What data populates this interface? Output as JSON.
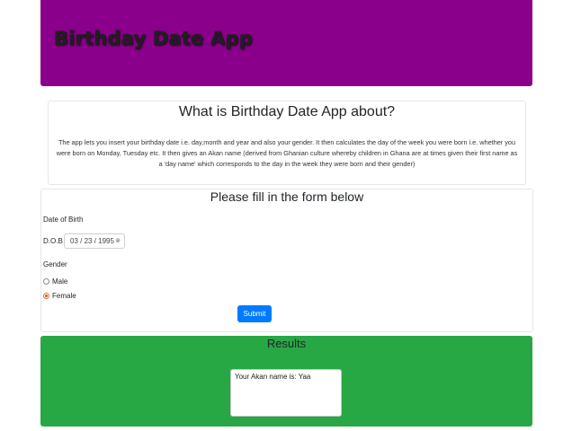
{
  "header": {
    "title": "Birthday Date App",
    "background_color": "#8b008b"
  },
  "about": {
    "heading": "What is Birthday Date App about?",
    "description": "The app lets you insert your birthday date i.e. day,month and year and also your gender. It then calculates the day of the week you were born i.e. whether you were born on Monday, Tuesday etc. It then gives an Akan name (derived from Ghanian culture whereby children in Ghana are at times given their first name as a 'day name' which corresponds to the day in the week they were born and their gender)"
  },
  "form": {
    "heading": "Please fill in the form below",
    "dob_section_label": "Date of Birth",
    "dob_prefix": "D.O.B",
    "dob_value": "03 / 23 / 1995",
    "dob_clear_icon": "clear-icon",
    "gender_label": "Gender",
    "gender_options": [
      {
        "label": "Male",
        "selected": false
      },
      {
        "label": "Female",
        "selected": true
      }
    ],
    "submit_label": "Submit",
    "submit_color": "#007bff"
  },
  "results": {
    "heading": "Results",
    "output_text": "Your Akan name is: Yaa",
    "background_color": "#28a745"
  }
}
